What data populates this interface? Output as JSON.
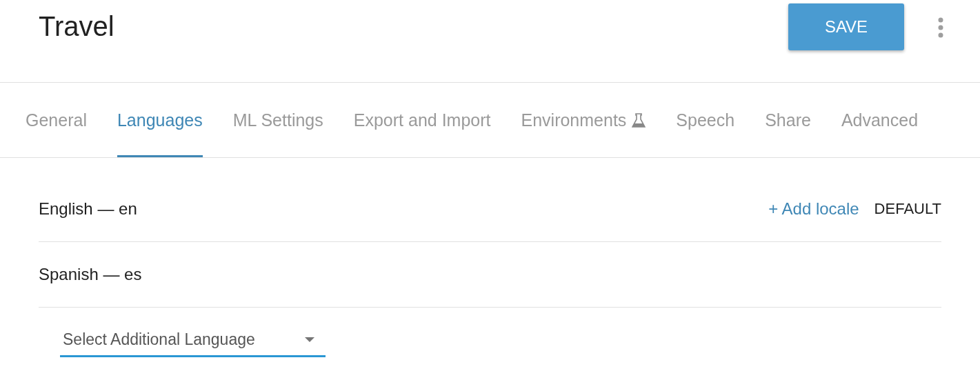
{
  "header": {
    "title": "Travel",
    "save_button": "SAVE"
  },
  "tabs": [
    {
      "label": "General",
      "selected": false,
      "kind": "plain"
    },
    {
      "label": "Languages",
      "selected": true,
      "kind": "plain"
    },
    {
      "label": "ML Settings",
      "selected": false,
      "kind": "plain"
    },
    {
      "label": "Export and Import",
      "selected": false,
      "kind": "plain"
    },
    {
      "label": "Environments",
      "selected": false,
      "kind": "experimental"
    },
    {
      "label": "Speech",
      "selected": false,
      "kind": "plain"
    },
    {
      "label": "Share",
      "selected": false,
      "kind": "plain"
    },
    {
      "label": "Advanced",
      "selected": false,
      "kind": "plain"
    }
  ],
  "languages": [
    {
      "name": "English — en",
      "action": "+ Add locale",
      "badge": "DEFAULT"
    },
    {
      "name": "Spanish — es"
    }
  ],
  "language_select": {
    "placeholder": "Select Additional Language"
  }
}
